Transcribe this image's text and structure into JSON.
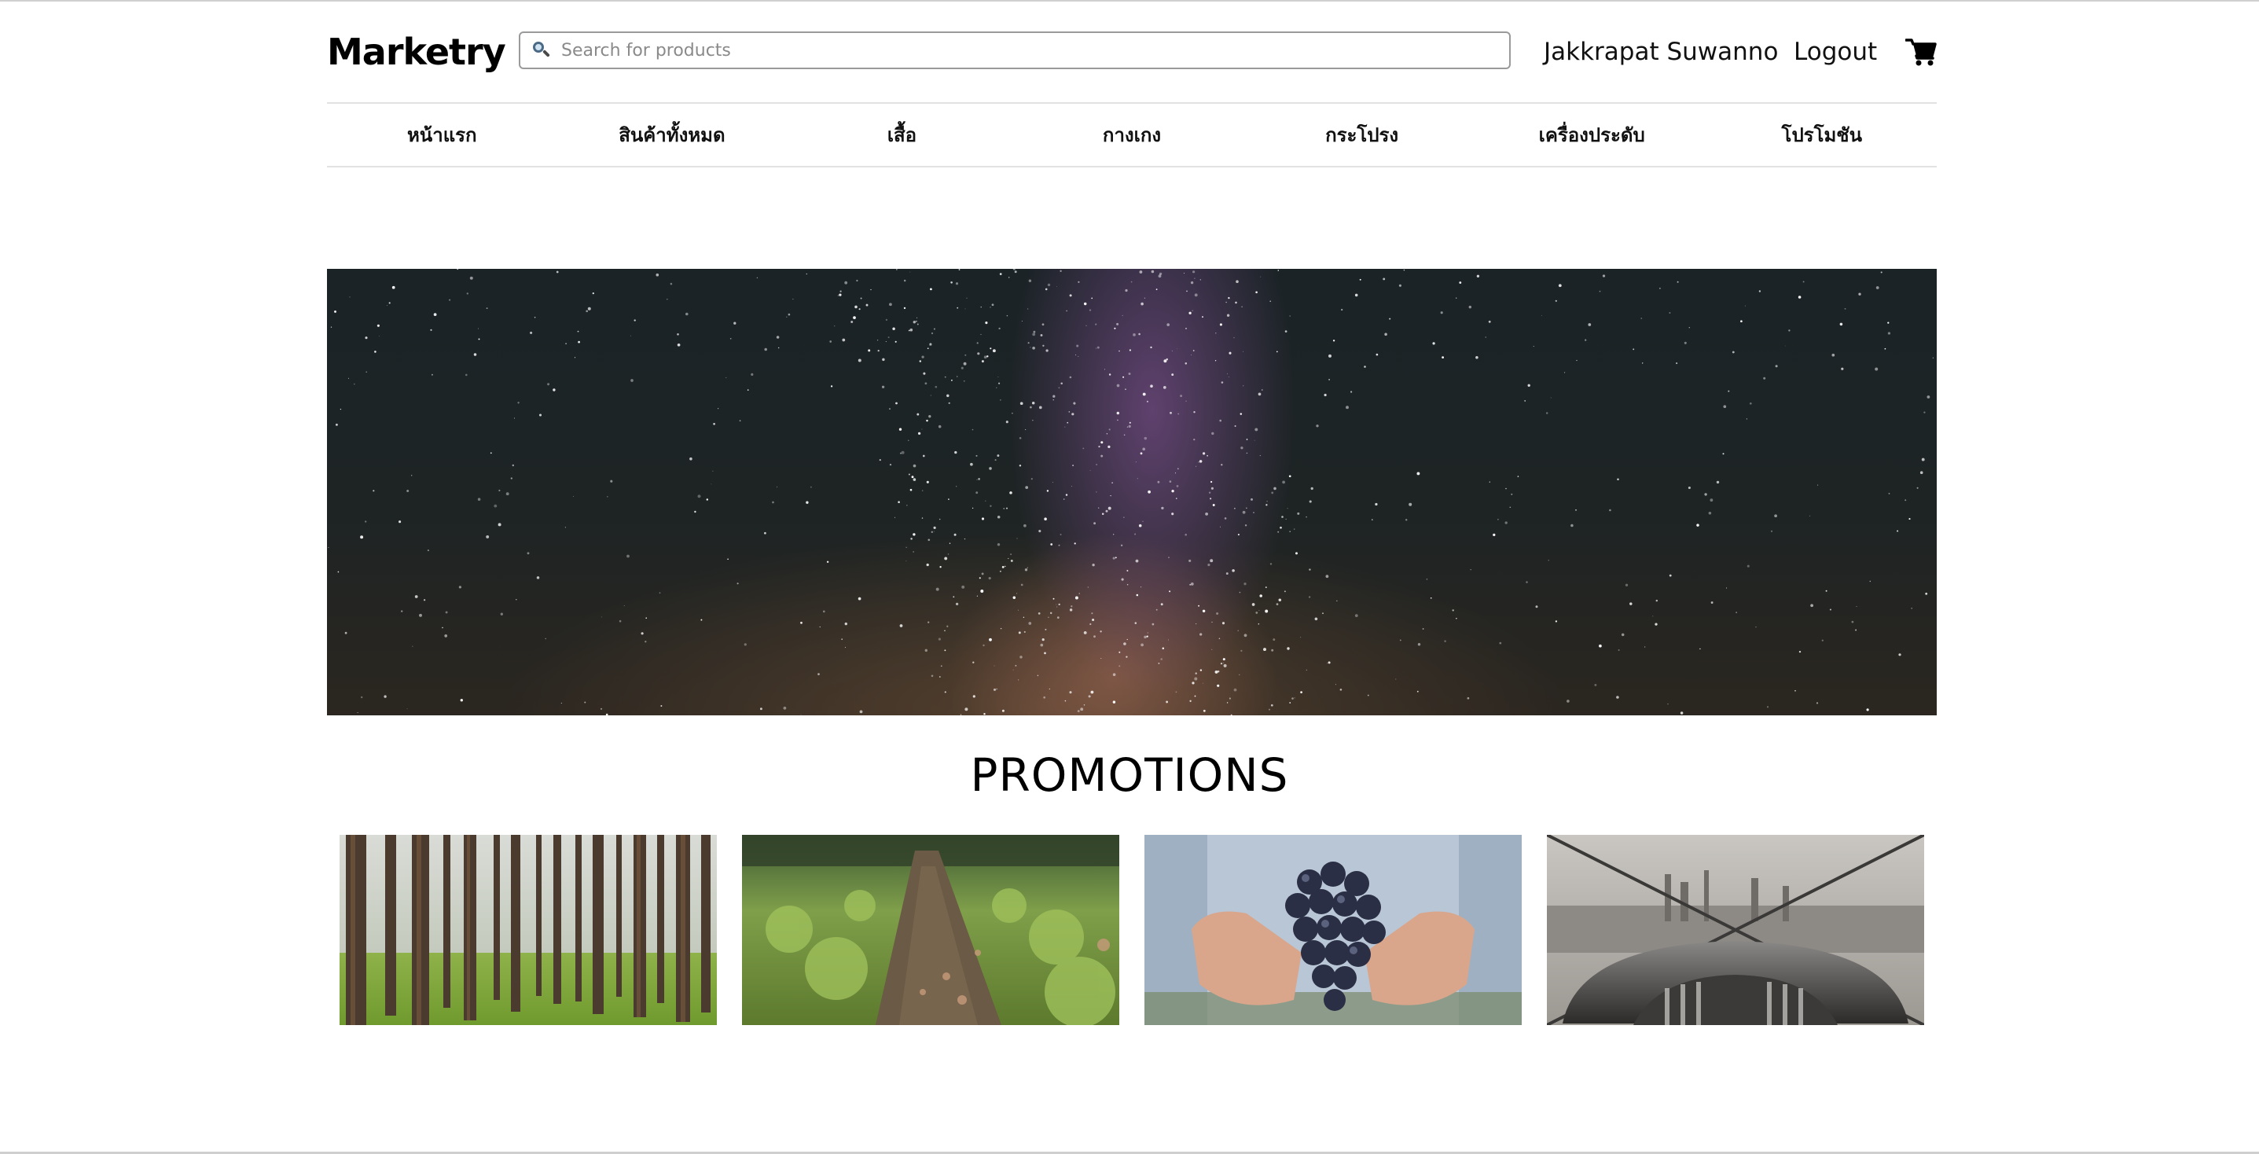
{
  "header": {
    "logo": "Marketry",
    "search_placeholder": "Search for products",
    "user_name": "Jakkrapat Suwanno",
    "logout_label": "Logout",
    "icons": {
      "search": "search-icon",
      "cart": "cart-icon"
    }
  },
  "nav": {
    "items": [
      {
        "label": "หน้าแรก"
      },
      {
        "label": "สินค้าทั้งหมด"
      },
      {
        "label": "เสื้อ"
      },
      {
        "label": "กางเกง"
      },
      {
        "label": "กระโปรง"
      },
      {
        "label": "เครื่องประดับ"
      },
      {
        "label": "โปรโมชัน"
      }
    ]
  },
  "hero": {
    "image": "starry-night-milky-way"
  },
  "promotions": {
    "title": "PROMOTIONS",
    "cards": [
      {
        "image": "pine-forest"
      },
      {
        "image": "forest-path"
      },
      {
        "image": "hands-holding-grapes"
      },
      {
        "image": "city-view-observation-deck"
      }
    ]
  },
  "colors": {
    "text": "#000000",
    "border": "#9a9a9a",
    "divider": "#e2e2e2"
  }
}
